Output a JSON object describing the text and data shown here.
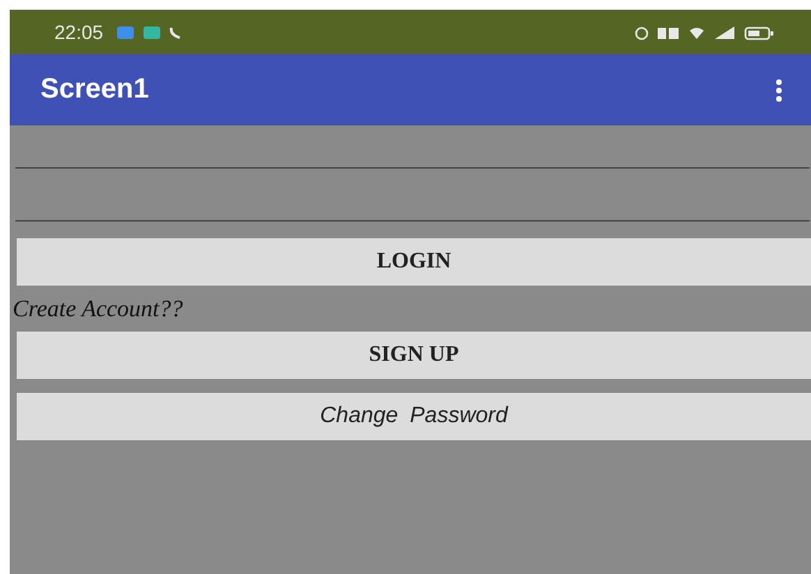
{
  "status_bar": {
    "time": "22:05"
  },
  "app_bar": {
    "title": "Screen1"
  },
  "content": [
    {
      "kind": "field"
    },
    {
      "kind": "field"
    },
    {
      "kind": "button",
      "label": "LOGIN"
    },
    {
      "kind": "label",
      "text": "Create Account??"
    },
    {
      "kind": "button",
      "label": "SIGN UP"
    },
    {
      "kind": "plain-button",
      "label": "Change Password"
    }
  ]
}
